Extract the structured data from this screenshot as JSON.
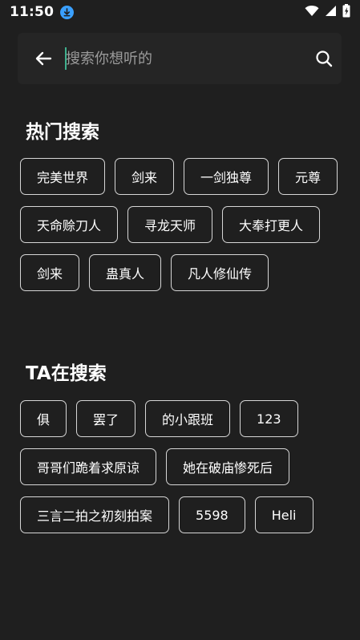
{
  "status_bar": {
    "time": "11:50",
    "icons": [
      "download-icon",
      "wifi-icon",
      "signal-icon",
      "battery-icon"
    ]
  },
  "search": {
    "placeholder": "搜索你想听的",
    "value": ""
  },
  "hot_search": {
    "title": "热门搜索",
    "items": [
      "完美世界",
      "剑来",
      "一剑独尊",
      "元尊",
      "天命赊刀人",
      "寻龙天师",
      "大奉打更人",
      "剑来",
      "蛊真人",
      "凡人修仙传"
    ]
  },
  "ta_search": {
    "title": "TA在搜索",
    "items": [
      "俱",
      "罢了",
      "的小跟班",
      "123",
      "哥哥们跪着求原谅",
      "她在破庙惨死后",
      "三言二拍之初刻拍案",
      "5598",
      "Heli"
    ]
  },
  "colors": {
    "background": "#1f1f1f",
    "search_bar": "#252525",
    "chip_border": "#d6d6d6",
    "caret": "#3fb08e",
    "download_badge": "#3aa0ff"
  }
}
